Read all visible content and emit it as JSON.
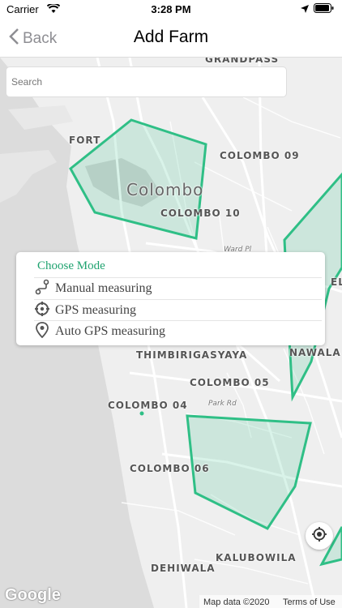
{
  "status_bar": {
    "carrier": "Carrier",
    "time": "3:28 PM"
  },
  "nav": {
    "back_label": "Back",
    "title": "Add Farm"
  },
  "search": {
    "placeholder": "Search"
  },
  "map": {
    "labels": {
      "grandpass": "GRANDPASS",
      "fort": "FORT",
      "colombo_09": "COLOMBO 09",
      "colombo": "Colombo",
      "colombo_10": "COLOMBO 10",
      "ward_pl": "Ward Pl",
      "thimbirigasyaya": "THIMBIRIGASYAYA",
      "nawala": "NAWALA",
      "colombo_05": "COLOMBO 05",
      "park_rd": "Park Rd",
      "colombo_04": "COLOMBO 04",
      "colombo_06": "COLOMBO 06",
      "kalubowila": "KALUBOWILA",
      "dehiwala": "DEHIWALA",
      "ela": "ELA"
    },
    "polygon_color": "#2fbf86",
    "polygon_fill": "rgba(47,191,134,0.18)"
  },
  "mode_panel": {
    "title": "Choose Mode",
    "items": [
      {
        "label": "Manual measuring",
        "icon": "route-icon"
      },
      {
        "label": "GPS measuring",
        "icon": "crosshair-icon"
      },
      {
        "label": "Auto GPS measuring",
        "icon": "map-pin-icon"
      }
    ]
  },
  "footer": {
    "google": "Google",
    "map_data": "Map data ©2020",
    "terms": "Terms of Use"
  }
}
